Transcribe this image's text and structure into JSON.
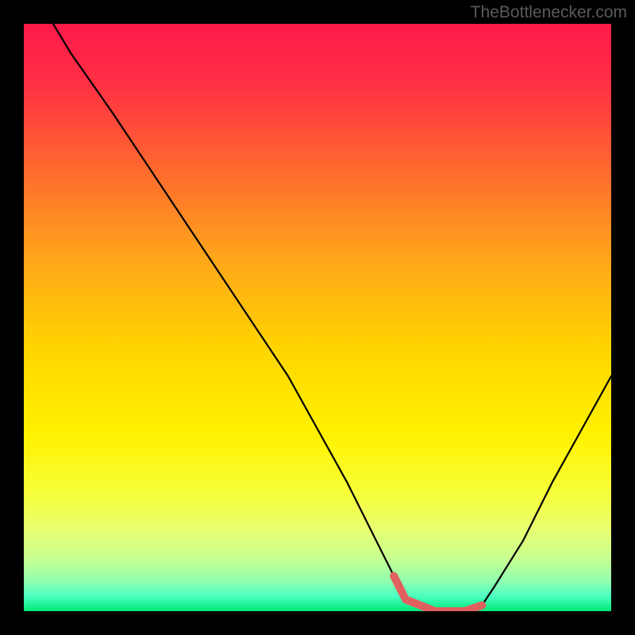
{
  "attribution": "TheBottlenecker.com",
  "chart_data": {
    "type": "line",
    "title": "",
    "xlabel": "",
    "ylabel": "",
    "xlim": [
      0,
      100
    ],
    "ylim": [
      0,
      100
    ],
    "series": [
      {
        "name": "curve",
        "x": [
          5,
          8,
          15,
          25,
          35,
          45,
          55,
          60,
          63,
          65,
          70,
          75,
          78,
          80,
          85,
          90,
          95,
          100
        ],
        "y": [
          100,
          95,
          85,
          70,
          55,
          40,
          22,
          12,
          6,
          2,
          0,
          0,
          1,
          4,
          12,
          22,
          31,
          40
        ]
      }
    ],
    "highlight_segment": {
      "name": "optimal-range",
      "x": [
        63,
        65,
        70,
        75,
        78
      ],
      "y": [
        6,
        2,
        0,
        0,
        1
      ]
    },
    "gradient_stops": [
      {
        "pos": 0.0,
        "color": "#ff1a4a"
      },
      {
        "pos": 0.1,
        "color": "#ff2f44"
      },
      {
        "pos": 0.25,
        "color": "#ff6a2e"
      },
      {
        "pos": 0.4,
        "color": "#ffa61a"
      },
      {
        "pos": 0.55,
        "color": "#ffd400"
      },
      {
        "pos": 0.7,
        "color": "#fff200"
      },
      {
        "pos": 0.8,
        "color": "#f6ff3a"
      },
      {
        "pos": 0.86,
        "color": "#e8ff70"
      },
      {
        "pos": 0.91,
        "color": "#c8ff90"
      },
      {
        "pos": 0.95,
        "color": "#8fffb0"
      },
      {
        "pos": 0.975,
        "color": "#4affc0"
      },
      {
        "pos": 1.0,
        "color": "#00e878"
      }
    ]
  }
}
